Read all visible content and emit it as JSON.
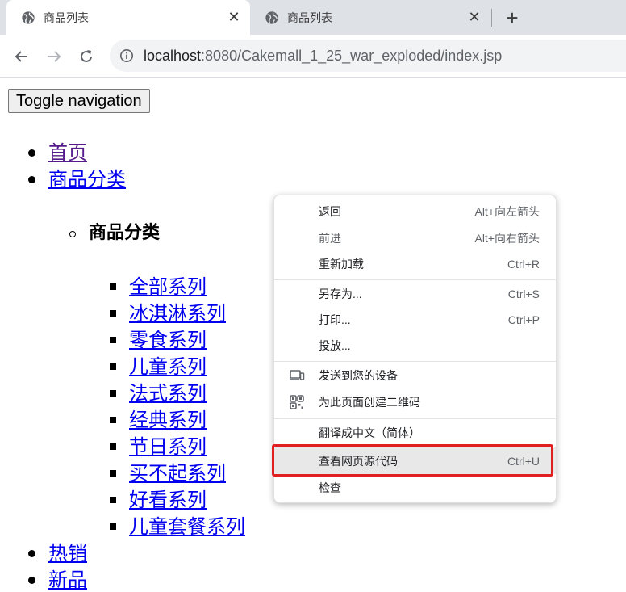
{
  "browser": {
    "tabs": [
      {
        "title": "商品列表",
        "active": true,
        "icon": "globe-icon"
      },
      {
        "title": "商品列表",
        "active": false,
        "icon": "globe-icon"
      }
    ],
    "close_glyph": "✕",
    "new_tab_glyph": "+",
    "url": {
      "host": "localhost",
      "rest": ":8080/Cakemall_1_25_war_exploded/index.jsp"
    }
  },
  "page": {
    "toggle_button": "Toggle navigation",
    "nav": {
      "home": "首页",
      "categories": "商品分类",
      "submenu_heading": "商品分类",
      "submenu_items": [
        "全部系列",
        "冰淇淋系列",
        "零食系列",
        "儿童系列",
        "法式系列",
        "经典系列",
        "节日系列",
        "买不起系列",
        "好看系列",
        "儿童套餐系列"
      ],
      "hot": "热销",
      "new": "新品"
    }
  },
  "context_menu": {
    "items": [
      {
        "label": "返回",
        "shortcut": "Alt+向左箭头",
        "disabled": false
      },
      {
        "label": "前进",
        "shortcut": "Alt+向右箭头",
        "disabled": true
      },
      {
        "label": "重新加载",
        "shortcut": "Ctrl+R",
        "disabled": false
      },
      {
        "label": "另存为...",
        "shortcut": "Ctrl+S",
        "disabled": false
      },
      {
        "label": "打印...",
        "shortcut": "Ctrl+P",
        "disabled": false
      },
      {
        "label": "投放...",
        "shortcut": "",
        "disabled": false
      },
      {
        "label": "发送到您的设备",
        "shortcut": "",
        "icon": "device-icon"
      },
      {
        "label": "为此页面创建二维码",
        "shortcut": "",
        "icon": "qr-code-icon"
      },
      {
        "label": "翻译成中文（简体）",
        "shortcut": ""
      },
      {
        "label": "查看网页源代码",
        "shortcut": "Ctrl+U",
        "highlighted": true
      },
      {
        "label": "检查",
        "shortcut": ""
      }
    ]
  },
  "colors": {
    "tab_strip": "#dee1e6",
    "link": "#0000ee",
    "visited_link": "#551a8b",
    "highlight_frame": "#e02020"
  }
}
